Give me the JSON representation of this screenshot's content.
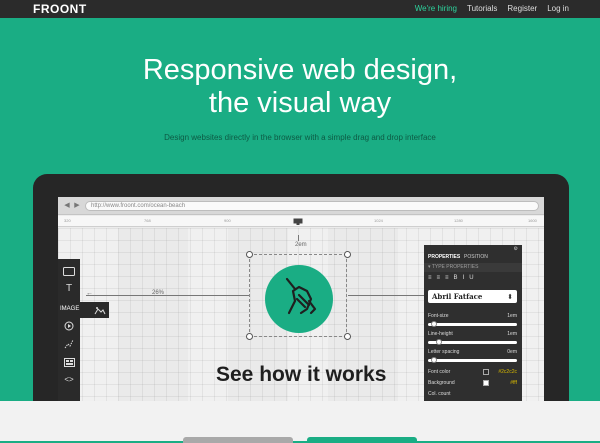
{
  "nav": {
    "logo": "FROONT",
    "links": [
      "We're hiring",
      "Tutorials",
      "Register",
      "Log in"
    ],
    "accent_color": "#2dd39d"
  },
  "hero": {
    "title_line1": "Responsive web design,",
    "title_line2": "the visual way",
    "subtitle": "Design websites directly in the browser with a simple drag and drop interface",
    "bg_color": "#1aad84"
  },
  "browser": {
    "url": "http://www.froont.com/ocean-beach",
    "back_icon": "chevron-left-icon",
    "forward_icon": "chevron-right-icon",
    "ruler_ticks": [
      "320",
      "768",
      "900",
      "1024",
      "1280",
      "1600"
    ],
    "device_icon": "monitor-icon"
  },
  "canvas": {
    "top_dimension": "2em",
    "left_dimension": "26%",
    "heading": "See how it works",
    "image_icon": "pen-in-hand-icon"
  },
  "toolbar": {
    "tools": [
      "box-icon",
      "text-icon",
      "image-icon",
      "video-icon",
      "path-icon",
      "gallery-icon",
      "code-icon"
    ],
    "text_label": "T",
    "image_label": "IMAGE"
  },
  "properties": {
    "tabs": [
      "PROPERTIES",
      "POSITION"
    ],
    "section": "TYPE PROPERTIES",
    "align_buttons": [
      "B",
      "I",
      "U"
    ],
    "font": "Abril Fatface",
    "font_size_label": "Font-size",
    "font_size_value": "1em",
    "line_height_label": "Line-height",
    "line_height_value": "1em",
    "letter_spacing_label": "Letter spacing",
    "letter_spacing_value": "0em",
    "font_color_label": "Font color",
    "font_color_value": "#2c2c2c",
    "background_label": "Background",
    "background_value": "#fff",
    "col_count_label": "Col. count"
  }
}
